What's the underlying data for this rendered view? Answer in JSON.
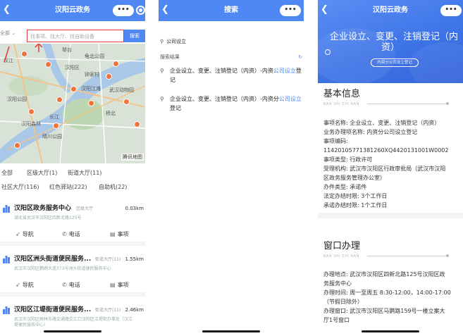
{
  "panel1": {
    "title": "汉阳云政务",
    "capsule_dots": "•••",
    "search": {
      "area": "全部",
      "placeholder": "找事项、找大厅、找自助设备",
      "button": "搜索"
    },
    "map": {
      "labels": [
        "汉阳区",
        "琴台",
        "龟北公园",
        "汉阳江滩",
        "汉阳森林",
        "长江",
        "桥北",
        "汉江",
        "汉阳公园",
        "钟家村",
        "武汉动物园",
        "晴川公园"
      ],
      "logo": "腾讯地图"
    },
    "tabs_row1": [
      "全部",
      "区级大厅(1)",
      "街道大厅(11)"
    ],
    "tabs_row2": [
      "社区大厅(116)",
      "红色驿站(222)",
      "自助机(22)"
    ],
    "cards": [
      {
        "name": "汉阳区政务服务中心",
        "tag": "区级大厅",
        "distance": "0.03km",
        "address": "湖北省武汉市汉阳区四新北路125号",
        "address2": ""
      },
      {
        "name": "汉阳区洲头街道便民服务...",
        "tag": "街道大厅(11)",
        "distance": "1.55km",
        "address": "武汉市汉阳区鹦鹉大道373号洲头街道便民服务中心",
        "address2": ""
      },
      {
        "name": "汉阳区江堤街道便民服务...",
        "tag": "街道大厅(11)",
        "distance": "2.46km",
        "address": "武汉市汉阳区梅林东路交通路交汇口汉阳区江堤街办事处（汉江",
        "address2": "堤便民服务中心）"
      }
    ],
    "actions": {
      "nav": "导航",
      "phone": "电话",
      "item": "事项"
    }
  },
  "panel2": {
    "title": "搜索",
    "capsule_dots": "•••",
    "query": "公司设立",
    "result_header": "搜索结果",
    "results": [
      {
        "prefix": "企业设立、变更、注销登记（内资）-内资",
        "highlight": "公司设立",
        "suffix": "登记"
      },
      {
        "prefix": "企业设立、变更、注销登记（内资）-内资分",
        "highlight": "公司设立",
        "suffix": "登记"
      }
    ]
  },
  "panel3": {
    "title": "汉阳云政务",
    "capsule_dots": "•••",
    "hero_title_line1": "企业设立、变更、注销登记（内",
    "hero_title_line2": "资）",
    "hero_pill": "内资分公司设立登记",
    "section1": {
      "heading": "基本信息",
      "pinyin": "BAN SHI ZHI NAN",
      "lines": [
        "事项名称: 企业设立、变更、注销登记（内资）",
        "业务办理项名称: 内资分公司设立登记",
        "事项编码:",
        "11420105771381260XQ4420131001W0002",
        "事项类型: 行政许可",
        "受理机构: 武汉市汉阳区行政审批局（武汉市汉阳",
        "区政务服务管理办公室）",
        "办件类型: 承诺件",
        "法定办结时限: 3个工作日",
        "承诺办结时限: 1个工作日"
      ]
    },
    "section2": {
      "heading": "窗口办理",
      "pinyin": "BAN SHI ZHI NAN",
      "lines": [
        "办理地点: 武汉市汉阳区四新北路125号汉阳区政",
        "务服务中心",
        "办理时间: 周一至周五 8:30-12:00，14:00-17:00",
        "（节假日除外）",
        "办理窗口: 武汉市汉阳区马鹦路159号一楼立案大",
        "厅1号窗口"
      ]
    }
  }
}
